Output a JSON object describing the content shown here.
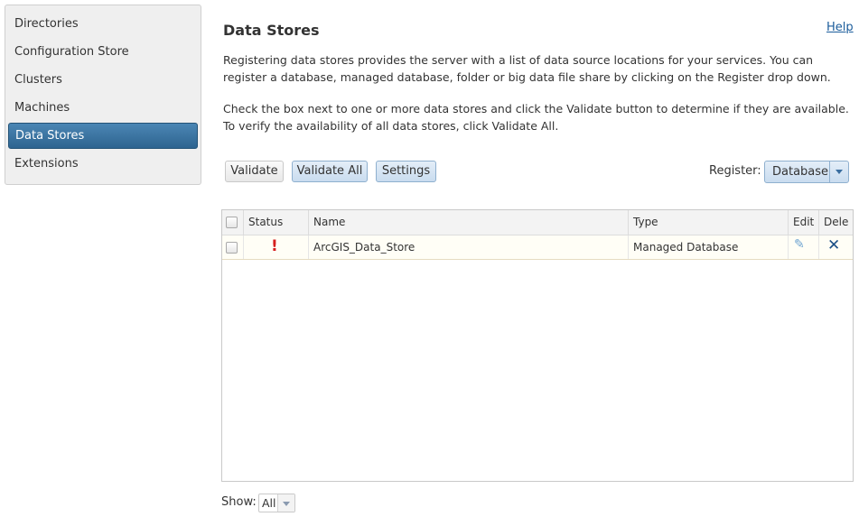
{
  "sidebar": {
    "items": [
      {
        "label": "Directories"
      },
      {
        "label": "Configuration Store"
      },
      {
        "label": "Clusters"
      },
      {
        "label": "Machines"
      },
      {
        "label": "Data Stores",
        "active": true
      },
      {
        "label": "Extensions"
      }
    ]
  },
  "main": {
    "title": "Data Stores",
    "help": "Help",
    "intro": "Registering data stores provides the server with a list of data source locations for your services. You can register a database, managed database, folder or big data file share by clicking on the Register drop down.",
    "instructions": "Check the box next to one or more data stores and click the Validate button to determine if they are available. To verify the availability of all data stores, click Validate All."
  },
  "toolbar": {
    "validate": "Validate",
    "validate_all": "Validate All",
    "settings": "Settings",
    "register_label": "Register:",
    "register_value": "Database"
  },
  "grid": {
    "headers": {
      "status": "Status",
      "name": "Name",
      "type": "Type",
      "edit": "Edit",
      "delete": "Dele"
    },
    "rows": [
      {
        "status_icon": "!",
        "name": "ArcGIS_Data_Store",
        "type": "Managed Database",
        "edit_icon": "✎",
        "delete_icon": "✕"
      }
    ]
  },
  "footer": {
    "show_label": "Show:",
    "show_value": "All"
  },
  "colors": {
    "active_nav": "#2e6490",
    "error": "#d61f1f",
    "link": "#1b5c9b"
  }
}
